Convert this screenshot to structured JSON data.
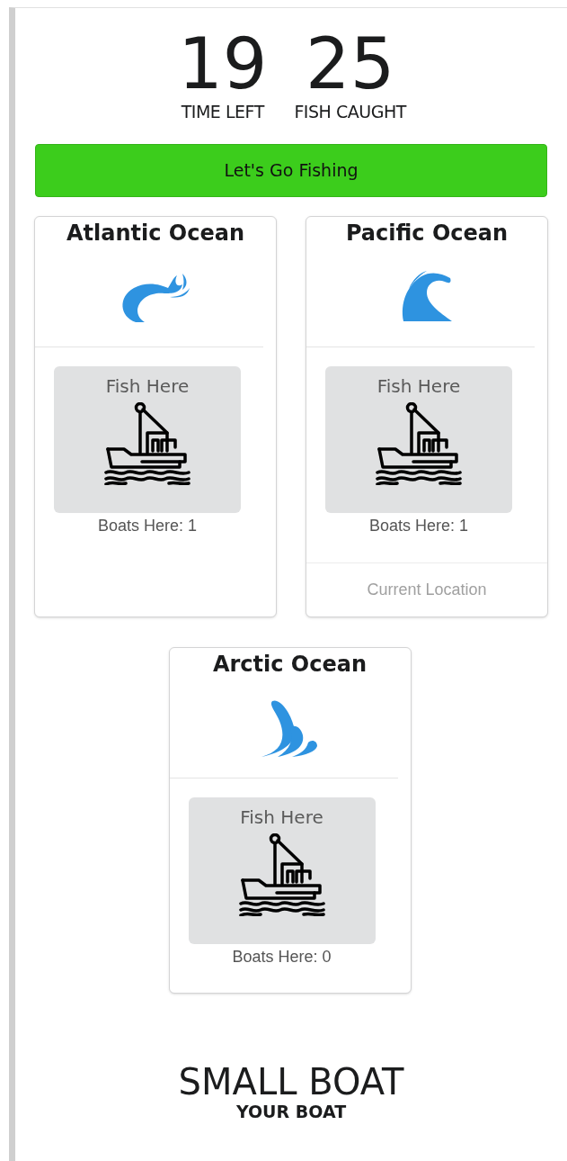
{
  "stats": [
    {
      "value": "19",
      "label": "TIME LEFT"
    },
    {
      "value": "25",
      "label": "FISH CAUGHT"
    }
  ],
  "action_button": "Let's Go Fishing",
  "oceans": [
    {
      "name": "Atlantic Ocean",
      "kind": "swirl",
      "action": "Fish Here",
      "boats": "Boats Here: 1"
    },
    {
      "name": "Pacific Ocean",
      "kind": "wave",
      "action": "Fish Here",
      "boats": "Boats Here: 1",
      "footer": "Current Location"
    },
    {
      "name": "Arctic Ocean",
      "kind": "splash",
      "action": "Fish Here",
      "boats": "Boats Here: 0"
    }
  ],
  "boat": {
    "name": "SMALL BOAT",
    "caption": "YOUR BOAT"
  }
}
